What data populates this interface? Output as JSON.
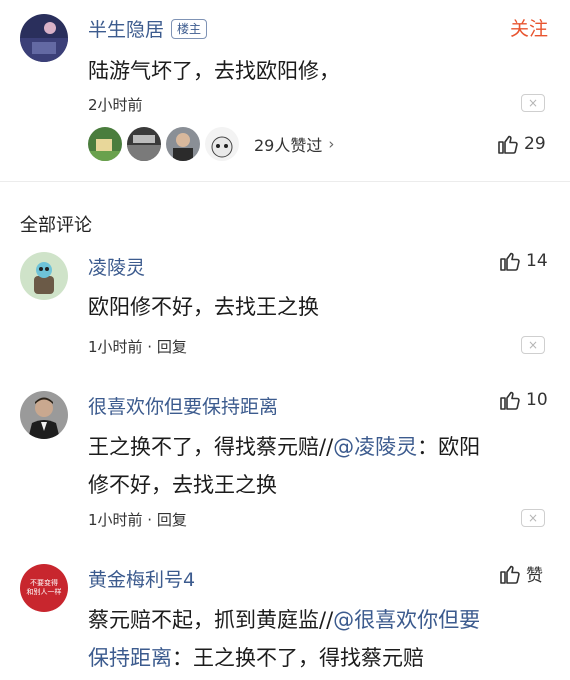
{
  "post": {
    "username": "半生隐居",
    "badge": "楼主",
    "follow_label": "关注",
    "text": "陆游气坏了，去找欧阳修，",
    "time": "2小时前",
    "likers_text": "29人赞过",
    "likers_chevron": "›",
    "like_count": "29"
  },
  "section_title": "全部评论",
  "comments": [
    {
      "username": "凌陵灵",
      "text": "欧阳修不好，去找王之换",
      "meta": "1小时前 · 回复",
      "likes": "14"
    },
    {
      "username": "很喜欢你但要保持距离",
      "text_line1_a": "王之换不了，得找蔡元赔//",
      "text_line1_mention": "@凌陵灵",
      "text_line1_b": "：欧阳",
      "text_line2": "修不好，去找王之换",
      "meta": "1小时前 · 回复",
      "likes": "10"
    },
    {
      "username": "黄金梅利号4",
      "avatar_text_1": "不要变得",
      "avatar_text_2": "和别人一样",
      "text_line1_a": "蔡元赔不起，抓到黄庭监//",
      "text_line1_mention": "@很喜欢你但要",
      "text_line2_mention": "保持距离",
      "text_line2_b": "：王之换不了，得找蔡元赔",
      "likes": "赞"
    }
  ],
  "icons": {
    "dismiss": "×",
    "like": "thumbs-up-icon"
  },
  "colors": {
    "link": "#3c5b8e",
    "follow": "#e8542f",
    "text": "#1c1c1c"
  }
}
